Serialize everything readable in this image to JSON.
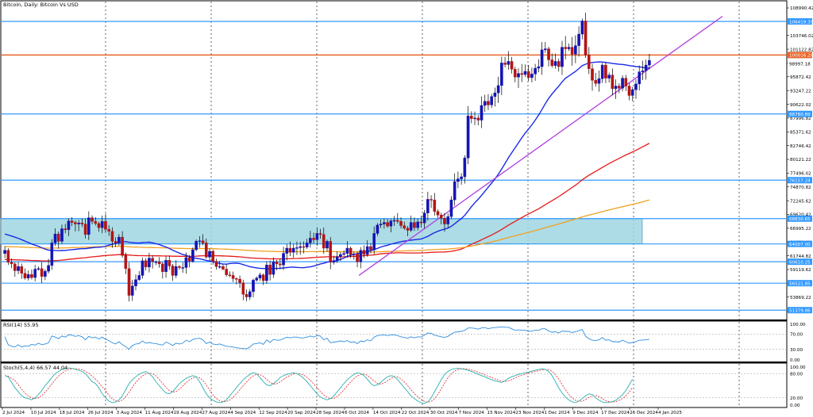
{
  "title": "Bitcoin, Daily:  Bitcoin Vs USD",
  "colors": {
    "bull": "#1414b4",
    "bear": "#b41414",
    "ma_blue": "#1a2ae6",
    "ma_red": "#e61a1a",
    "ma_orange": "#f0a020",
    "trendline": "#b040e0",
    "hline": "#3399ff",
    "current_line": "#e8642a",
    "zone": "#9fd6e2",
    "rsi": "#2f8fdf",
    "stoch_main": "#2ab0b0",
    "stoch_signal": "#e02020",
    "axis_label_bg": "#3399ff"
  },
  "chart_data": {
    "type": "candlestick",
    "price_axis_ticks": [
      "108990.42",
      "103746.02",
      "101122.82",
      "98497.62",
      "95872.42",
      "93247.22",
      "90622.02",
      "87996.82",
      "85371.62",
      "82746.42",
      "80121.22",
      "77496.02",
      "74870.82",
      "72245.62",
      "69620.42",
      "66995.22",
      "64370.02",
      "61744.82",
      "59119.62",
      "56494.42",
      "53869.22",
      "51244.02"
    ],
    "price_range": [
      49600,
      110200
    ],
    "levels": [
      {
        "value": 106419.39,
        "label": "106419.39"
      },
      {
        "value": 100016.28,
        "label": "100016.28"
      },
      {
        "value": 88780.89,
        "label": "88780.89"
      },
      {
        "value": 76157.24,
        "label": "76157.24"
      },
      {
        "value": 68830.65,
        "label": "68830.65"
      },
      {
        "value": 64007.0,
        "label": "64007.00"
      },
      {
        "value": 60610.25,
        "label": "60610.25"
      },
      {
        "value": 56521.85,
        "label": "56521.85"
      },
      {
        "value": 51379.86,
        "label": "51379.86"
      }
    ],
    "current_price_label": "98997.18",
    "demand_zone": [
      64007.0,
      68830.65
    ],
    "date_labels": [
      "2 Jul 2024",
      "10 Jul 2024",
      "18 Jul 2024",
      "26 Jul 2024",
      "3 Aug 2024",
      "11 Aug 2024",
      "19 Aug 2024",
      "27 Aug 2024",
      "4 Sep 2024",
      "12 Sep 2024",
      "20 Sep 2024",
      "28 Sep 2024",
      "6 Oct 2024",
      "14 Oct 2024",
      "22 Oct 2024",
      "30 Oct 2024",
      "7 Nov 2024",
      "15 Nov 2024",
      "23 Nov 2024",
      "1 Dec 2024",
      "9 Dec 2024",
      "17 Dec 2024",
      "26 Dec 2024",
      "4 Jan 2025"
    ],
    "closes": [
      62800,
      60500,
      60200,
      58900,
      59700,
      58400,
      57500,
      58200,
      57600,
      59200,
      59300,
      57800,
      58800,
      59900,
      64200,
      65900,
      64500,
      66900,
      66700,
      68400,
      68100,
      67800,
      68000,
      67800,
      65800,
      69000,
      68300,
      67900,
      67100,
      68300,
      66800,
      66400,
      64500,
      64200,
      65300,
      61800,
      59300,
      54200,
      56000,
      57200,
      58000,
      60800,
      59600,
      61300,
      60600,
      60600,
      60200,
      58700,
      60900,
      59800,
      58000,
      59700,
      59500,
      59500,
      61400,
      60700,
      62900,
      64500,
      64600,
      64200,
      61500,
      62600,
      60700,
      59700,
      59700,
      59200,
      58100,
      58000,
      57400,
      57300,
      56600,
      54400,
      53900,
      54900,
      57100,
      57500,
      58100,
      57000,
      60000,
      58200,
      60600,
      60200,
      60000,
      62200,
      63200,
      62400,
      63200,
      63300,
      63500,
      63400,
      64200,
      65100,
      64800,
      66000,
      65800,
      63200,
      64500,
      60500,
      60800,
      61600,
      62000,
      62200,
      63200,
      62000,
      62100,
      60600,
      62800,
      62000,
      63500,
      62900,
      66000,
      67600,
      67800,
      68100,
      67400,
      68400,
      68500,
      68300,
      67500,
      67000,
      66600,
      68100,
      67100,
      68200,
      68000,
      69900,
      72500,
      72400,
      70200,
      69500,
      68900,
      67800,
      69200,
      72400,
      75900,
      76400,
      76800,
      80400,
      88400,
      87900,
      88000,
      87600,
      90400,
      91200,
      90500,
      92100,
      92800,
      94200,
      98500,
      98200,
      98800,
      97300,
      95800,
      96500,
      96300,
      96900,
      95700,
      96400,
      97500,
      97800,
      101000,
      101200,
      99100,
      98000,
      98800,
      97800,
      101500,
      101200,
      101500,
      100200,
      101800,
      104000,
      106500,
      100000,
      97400,
      95200,
      94600,
      95500,
      98100,
      95600,
      96200,
      93600,
      94100,
      93700,
      95600,
      94100,
      92300,
      93400,
      94500,
      96800,
      97000,
      98100,
      98997
    ]
  },
  "rsi": {
    "label": "RSI(14) 55.95",
    "ticks": [
      "100.00",
      "70.00",
      "30.00",
      "0.00"
    ],
    "values": [
      63,
      42,
      38,
      36,
      42,
      36,
      39,
      38,
      43,
      41,
      46,
      42,
      44,
      47,
      65,
      62,
      58,
      65,
      62,
      68,
      67,
      64,
      66,
      63,
      55,
      64,
      60,
      62,
      57,
      62,
      56,
      53,
      47,
      44,
      50,
      42,
      37,
      30,
      40,
      44,
      45,
      52,
      46,
      48,
      46,
      45,
      43,
      41,
      49,
      45,
      40,
      46,
      44,
      46,
      54,
      50,
      56,
      58,
      59,
      55,
      45,
      49,
      44,
      42,
      44,
      41,
      38,
      37,
      36,
      34,
      33,
      32,
      31,
      36,
      44,
      45,
      47,
      43,
      55,
      48,
      56,
      54,
      54,
      58,
      62,
      60,
      62,
      62,
      60,
      60,
      62,
      65,
      62,
      66,
      65,
      55,
      59,
      47,
      49,
      50,
      52,
      50,
      53,
      48,
      50,
      45,
      52,
      50,
      55,
      52,
      62,
      66,
      67,
      68,
      66,
      68,
      68,
      66,
      63,
      61,
      59,
      63,
      60,
      63,
      62,
      67,
      73,
      72,
      67,
      65,
      63,
      61,
      64,
      70,
      75,
      76,
      77,
      80,
      86,
      86,
      85,
      83,
      86,
      87,
      84,
      86,
      87,
      88,
      89,
      88,
      88,
      84,
      80,
      81,
      80,
      80,
      77,
      78,
      80,
      80,
      84,
      84,
      78,
      75,
      76,
      73,
      78,
      77,
      77,
      74,
      76,
      79,
      82,
      64,
      58,
      54,
      53,
      55,
      61,
      54,
      55,
      50,
      50,
      49,
      54,
      50,
      46,
      48,
      50,
      54,
      54,
      55,
      56
    ]
  },
  "stochastic": {
    "label": "Stoch(5,4,4) 66.57 44.04",
    "ticks": [
      "100.00",
      "80.00",
      "20.00",
      "0.00"
    ],
    "main": [
      75,
      72,
      58,
      45,
      35,
      25,
      20,
      18,
      15,
      20,
      28,
      38,
      50,
      60,
      70,
      80,
      85,
      90,
      92,
      94,
      93,
      90,
      88,
      85,
      80,
      70,
      60,
      55,
      45,
      30,
      20,
      12,
      8,
      10,
      15,
      25,
      40,
      55,
      65,
      72,
      78,
      82,
      85,
      80,
      72,
      60,
      50,
      40,
      32,
      30,
      35,
      45,
      55,
      62,
      68,
      72,
      75,
      72,
      60,
      45,
      30,
      20,
      14,
      10,
      8,
      10,
      15,
      25,
      35,
      45,
      55,
      65,
      72,
      78,
      82,
      80,
      70,
      60,
      52,
      50,
      55,
      62,
      70,
      75,
      78,
      80,
      82,
      80,
      75,
      68,
      60,
      50,
      40,
      30,
      22,
      18,
      15,
      18,
      25,
      35,
      45,
      55,
      65,
      72,
      78,
      82,
      80,
      75,
      66,
      55,
      50,
      52,
      58,
      66,
      72,
      75,
      73,
      65,
      55,
      45,
      35,
      25,
      18,
      12,
      8,
      6,
      10,
      20,
      35,
      50,
      65,
      78,
      85,
      90,
      92,
      93,
      92,
      90,
      88,
      85,
      82,
      78,
      75,
      72,
      68,
      65,
      62,
      60,
      58,
      62,
      68,
      72,
      75,
      78,
      80,
      82,
      84,
      86,
      88,
      90,
      92,
      90,
      85,
      75,
      60,
      45,
      32,
      22,
      15,
      10,
      8,
      12,
      18,
      25,
      30,
      28,
      20,
      14,
      10,
      8,
      9,
      11,
      14,
      20,
      28,
      38,
      52,
      66
    ]
  }
}
